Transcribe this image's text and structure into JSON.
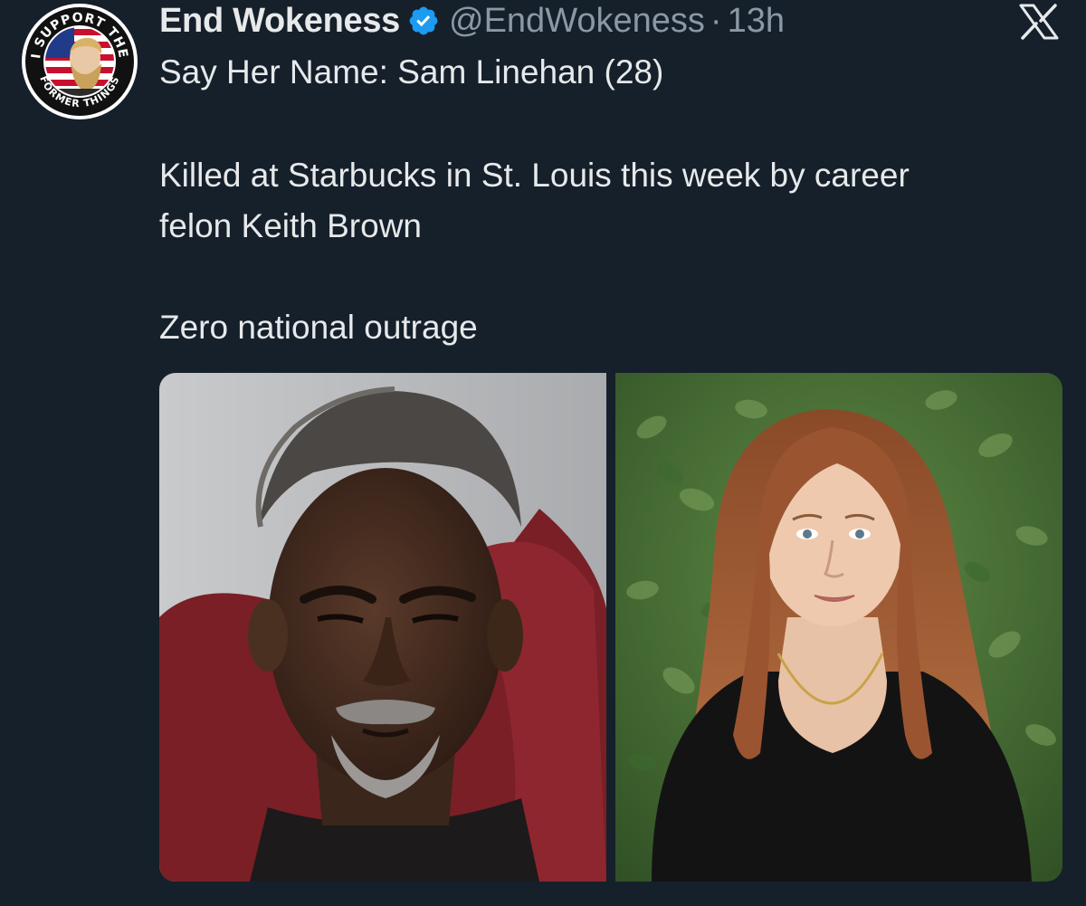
{
  "tweet": {
    "author": {
      "display_name": "End Wokeness",
      "handle": "@EndWokeness",
      "verified": true,
      "avatar": {
        "ring_text_top": "I SUPPORT THE",
        "ring_text_bottom": "FORMER THINGS"
      }
    },
    "separator": "·",
    "timestamp": "13h",
    "text_lines": [
      "Say Her Name: Sam Linehan (28)",
      "Killed at Starbucks in St. Louis this week by career",
      "felon Keith Brown",
      "Zero national outrage"
    ],
    "media": {
      "count": 2,
      "photos": [
        {
          "depicts": "man-mugshot"
        },
        {
          "depicts": "woman-portrait"
        }
      ]
    }
  },
  "icons": {
    "verified": "verified-badge-icon",
    "logo": "x-logo-icon"
  },
  "colors": {
    "background": "#15202b",
    "primary_text": "#e7e9ea",
    "secondary_text": "#8b98a5",
    "verified_blue": "#1d9bf0"
  }
}
